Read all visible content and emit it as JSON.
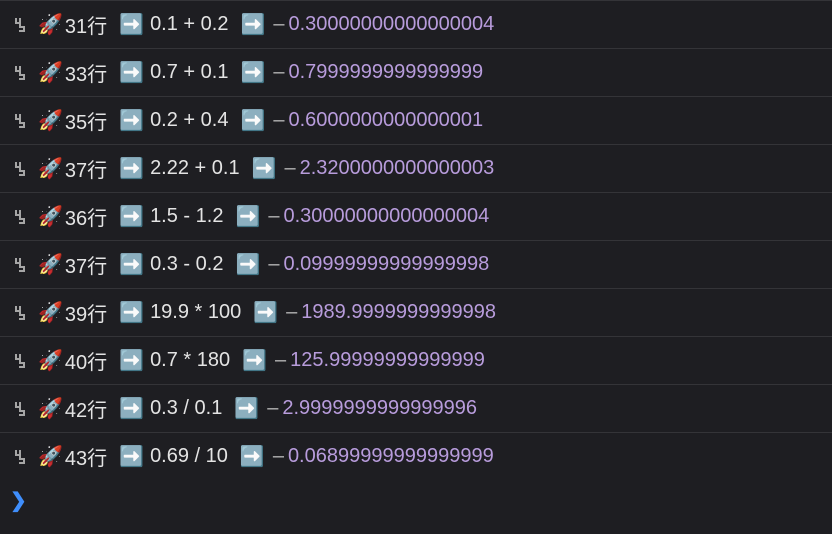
{
  "icons": {
    "level": "log-level-info",
    "rocket": "🚀",
    "arrow": "➡️"
  },
  "separators": {
    "dash": "–"
  },
  "prompt": {
    "symbol": "❯"
  },
  "rows": [
    {
      "line_label": "31行",
      "expression": "0.1 + 0.2",
      "result": "0.30000000000000004"
    },
    {
      "line_label": "33行",
      "expression": "0.7 + 0.1",
      "result": "0.7999999999999999"
    },
    {
      "line_label": "35行",
      "expression": "0.2 + 0.4",
      "result": "0.6000000000000001"
    },
    {
      "line_label": "37行",
      "expression": "2.22 + 0.1",
      "result": "2.3200000000000003"
    },
    {
      "line_label": "36行",
      "expression": "1.5 - 1.2",
      "result": "0.30000000000000004"
    },
    {
      "line_label": "37行",
      "expression": "0.3 - 0.2",
      "result": "0.09999999999999998"
    },
    {
      "line_label": "39行",
      "expression": "19.9 * 100",
      "result": "1989.9999999999998"
    },
    {
      "line_label": "40行",
      "expression": "0.7 * 180",
      "result": "125.99999999999999"
    },
    {
      "line_label": "42行",
      "expression": "0.3 / 0.1",
      "result": "2.9999999999999996"
    },
    {
      "line_label": "43行",
      "expression": "0.69 / 10",
      "result": "0.06899999999999999"
    }
  ]
}
